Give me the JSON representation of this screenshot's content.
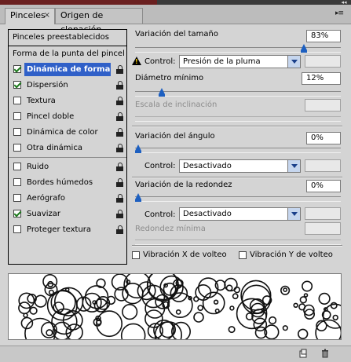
{
  "tabs": [
    {
      "label": "Pinceles",
      "close": "×"
    },
    {
      "label": "Origen de clonación"
    }
  ],
  "panel_menu_glyph": "▸≡",
  "collapse_glyph": "◂◂",
  "left_list": {
    "presets_label": "Pinceles preestablecidos",
    "tip_shape_label": "Forma de la punta del pincel",
    "items": [
      {
        "label": "Dinámica de forma",
        "checked": true,
        "selected": true
      },
      {
        "label": "Dispersión",
        "checked": true
      },
      {
        "label": "Textura",
        "checked": false
      },
      {
        "label": "Pincel doble",
        "checked": false
      },
      {
        "label": "Dinámica de color",
        "checked": false
      },
      {
        "label": "Otra dinámica",
        "checked": false
      },
      {
        "label": "Ruido",
        "checked": false
      },
      {
        "label": "Bordes húmedos",
        "checked": false
      },
      {
        "label": "Aerógrafo",
        "checked": false
      },
      {
        "label": "Suavizar",
        "checked": true
      },
      {
        "label": "Proteger textura",
        "checked": false
      }
    ]
  },
  "settings": {
    "size_jitter": {
      "label": "Variación del tamaño",
      "value": "83%",
      "slider_fraction": 0.83
    },
    "size_control": {
      "label": "Control:",
      "value": "Presión de la pluma"
    },
    "min_diameter": {
      "label": "Diámetro mínimo",
      "value": "12%",
      "slider_fraction": 0.12
    },
    "tilt_scale": {
      "label": "Escala de inclinación",
      "value": ""
    },
    "angle_jitter": {
      "label": "Variación del ángulo",
      "value": "0%",
      "slider_fraction": 0.0
    },
    "angle_control": {
      "label": "Control:",
      "value": "Desactivado"
    },
    "roundness_jitter": {
      "label": "Variación de la redondez",
      "value": "0%",
      "slider_fraction": 0.0
    },
    "roundness_control": {
      "label": "Control:",
      "value": "Desactivado"
    },
    "min_roundness": {
      "label": "Redondez mínima",
      "value": ""
    },
    "flip_x": {
      "label": "Vibración X de volteo",
      "checked": false
    },
    "flip_y": {
      "label": "Vibración Y de volteo",
      "checked": false
    }
  },
  "bottom_icons": [
    "new-preset-icon",
    "trash-icon"
  ],
  "colors": {
    "selection": "#3060c8",
    "thumb": "#1d5fc0",
    "check": "#1d7a1d"
  }
}
